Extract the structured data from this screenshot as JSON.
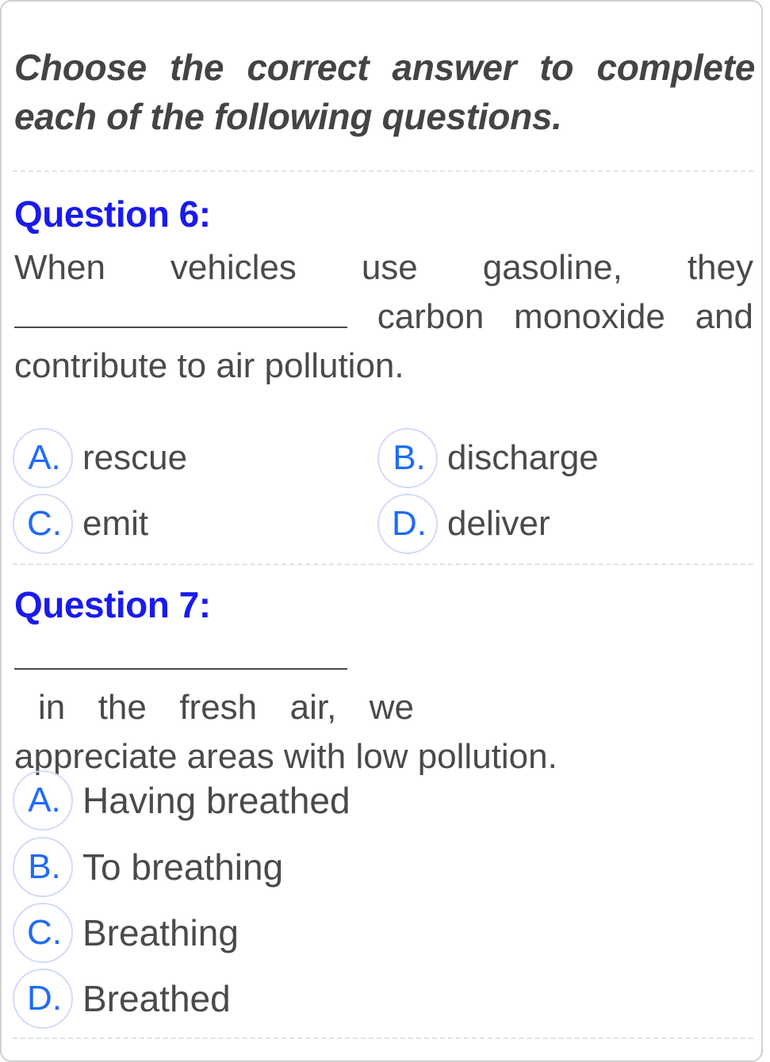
{
  "instruction": "Choose the correct answer to complete each of the following questions.",
  "questions": [
    {
      "title": "Question 6:",
      "lines": [
        [
          "When",
          "vehicles",
          "use",
          "gasoline,",
          "they"
        ],
        [
          "carbon",
          "monoxide",
          "and"
        ],
        "contribute to air pollution."
      ],
      "options": [
        {
          "letter": "A.",
          "text": "rescue"
        },
        {
          "letter": "B.",
          "text": "discharge"
        },
        {
          "letter": "C.",
          "text": "emit"
        },
        {
          "letter": "D.",
          "text": "deliver"
        }
      ]
    },
    {
      "title": "Question 7:",
      "lines": [
        "in the fresh air, we",
        "appreciate areas with low pollution."
      ],
      "options": [
        {
          "letter": "A.",
          "text": "Having breathed"
        },
        {
          "letter": "B.",
          "text": "To breathing"
        },
        {
          "letter": "C.",
          "text": "Breathing"
        },
        {
          "letter": "D.",
          "text": "Breathed"
        }
      ]
    }
  ],
  "colors": {
    "heading": "#1a1aee",
    "option_letter": "#1f6bf5",
    "option_circle_border": "#d4daf8",
    "body_text": "#4a4a4a"
  }
}
